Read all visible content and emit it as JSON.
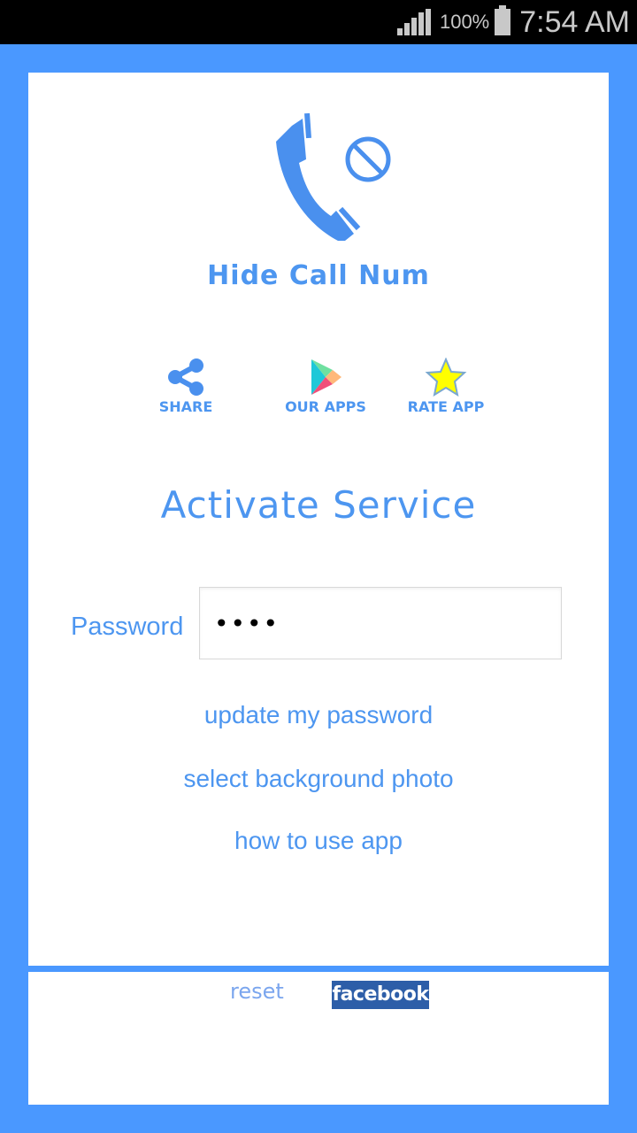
{
  "status_bar": {
    "battery_percent": "100%",
    "time": "7:54 AM",
    "signal_icon": "signal-strength-icon",
    "battery_icon": "battery-full-icon"
  },
  "app": {
    "title": "Hide Call Num",
    "logo_icon": "phone-blocked-icon"
  },
  "actions": [
    {
      "label": "SHARE",
      "icon": "share-icon"
    },
    {
      "label": "OUR APPS",
      "icon": "play-store-icon"
    },
    {
      "label": "RATE APP",
      "icon": "star-icon"
    }
  ],
  "service": {
    "title": "Activate Service",
    "password_label": "Password",
    "password_value": "••••"
  },
  "links": [
    {
      "label": "update my password"
    },
    {
      "label": "select background photo"
    },
    {
      "label": "how to use app"
    }
  ],
  "footer": {
    "reset_label": "reset",
    "facebook_label": "facebook"
  },
  "colors": {
    "frame": "#4a98ff",
    "accent": "#4d96f0",
    "facebook": "#2d5ea8",
    "star": "#ffff00"
  }
}
